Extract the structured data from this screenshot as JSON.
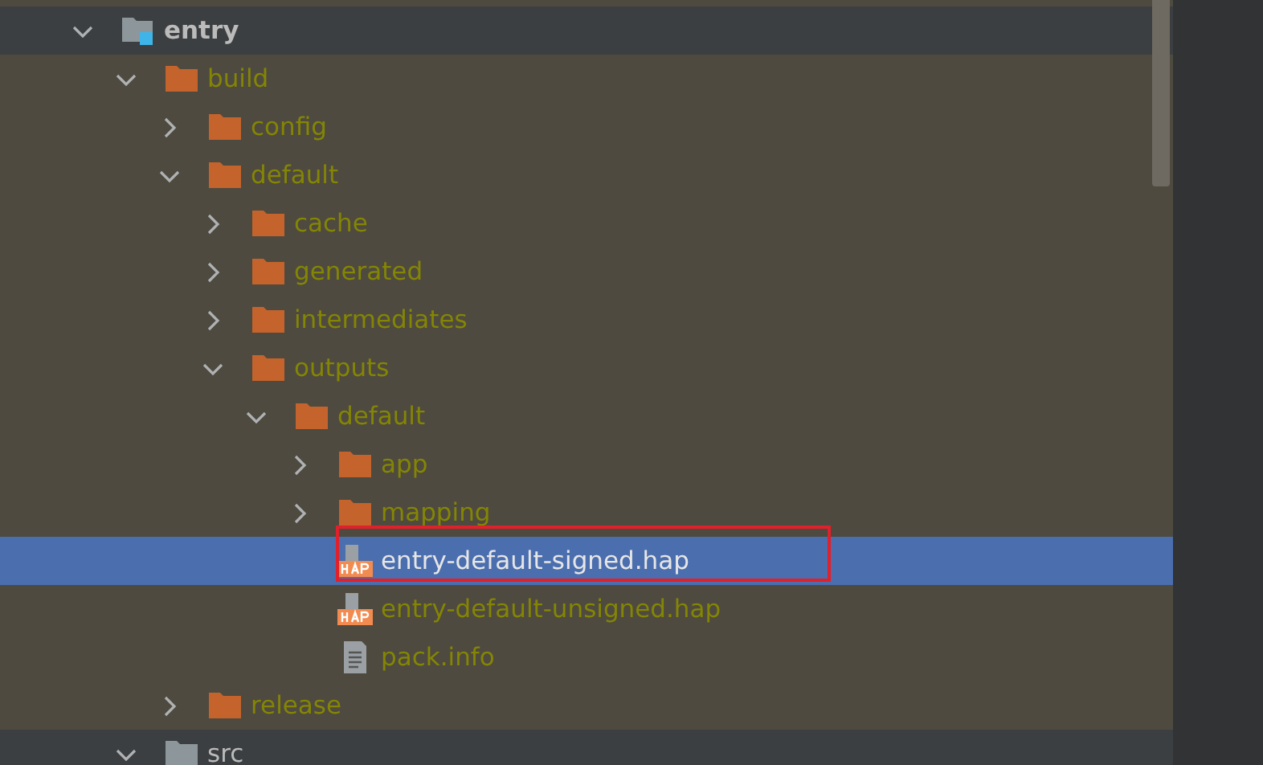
{
  "tree": [
    {
      "label": "entry",
      "kind": "module",
      "expanded": true,
      "excluded": false,
      "selected": false,
      "highlighted": false,
      "children": [
        {
          "label": "build",
          "kind": "folder",
          "expanded": true,
          "excluded": true,
          "selected": false,
          "highlighted": false,
          "children": [
            {
              "label": "config",
              "kind": "folder",
              "expanded": false,
              "excluded": true,
              "selected": false,
              "highlighted": false
            },
            {
              "label": "default",
              "kind": "folder",
              "expanded": true,
              "excluded": true,
              "selected": false,
              "highlighted": false,
              "children": [
                {
                  "label": "cache",
                  "kind": "folder",
                  "expanded": false,
                  "excluded": true,
                  "selected": false,
                  "highlighted": false
                },
                {
                  "label": "generated",
                  "kind": "folder",
                  "expanded": false,
                  "excluded": true,
                  "selected": false,
                  "highlighted": false
                },
                {
                  "label": "intermediates",
                  "kind": "folder",
                  "expanded": false,
                  "excluded": true,
                  "selected": false,
                  "highlighted": false
                },
                {
                  "label": "outputs",
                  "kind": "folder",
                  "expanded": true,
                  "excluded": true,
                  "selected": false,
                  "highlighted": false,
                  "children": [
                    {
                      "label": "default",
                      "kind": "folder",
                      "expanded": true,
                      "excluded": true,
                      "selected": false,
                      "highlighted": false,
                      "children": [
                        {
                          "label": "app",
                          "kind": "folder",
                          "expanded": false,
                          "excluded": true,
                          "selected": false,
                          "highlighted": false
                        },
                        {
                          "label": "mapping",
                          "kind": "folder",
                          "expanded": false,
                          "excluded": true,
                          "selected": false,
                          "highlighted": false
                        },
                        {
                          "label": "entry-default-signed.hap",
                          "kind": "hap",
                          "excluded": true,
                          "selected": true,
                          "highlighted": true
                        },
                        {
                          "label": "entry-default-unsigned.hap",
                          "kind": "hap",
                          "excluded": true,
                          "selected": false,
                          "highlighted": false
                        },
                        {
                          "label": "pack.info",
                          "kind": "text",
                          "excluded": true,
                          "selected": false,
                          "highlighted": false
                        }
                      ]
                    }
                  ]
                }
              ]
            },
            {
              "label": "release",
              "kind": "folder",
              "expanded": false,
              "excluded": true,
              "selected": false,
              "highlighted": false
            }
          ]
        },
        {
          "label": "src",
          "kind": "plain-folder",
          "expanded": true,
          "excluded": false,
          "selected": false,
          "highlighted": false
        }
      ]
    }
  ]
}
